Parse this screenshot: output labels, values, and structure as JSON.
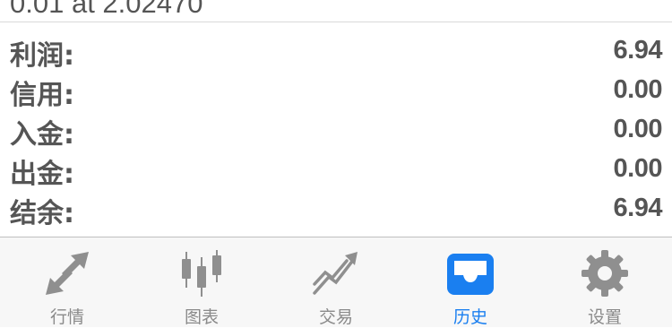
{
  "order_line": "0.01 at 2.02470",
  "summary": {
    "rows": [
      {
        "label": "利润:",
        "value": "6.94"
      },
      {
        "label": "信用:",
        "value": "0.00"
      },
      {
        "label": "入金:",
        "value": "0.00"
      },
      {
        "label": "出金:",
        "value": "0.00"
      },
      {
        "label": "结余:",
        "value": "6.94"
      }
    ]
  },
  "tabbar": {
    "tabs": [
      {
        "label": "行情",
        "icon": "quotes-arrows-icon",
        "active": false
      },
      {
        "label": "图表",
        "icon": "candlestick-chart-icon",
        "active": false
      },
      {
        "label": "交易",
        "icon": "trade-trend-icon",
        "active": false
      },
      {
        "label": "历史",
        "icon": "history-inbox-icon",
        "active": true
      },
      {
        "label": "设置",
        "icon": "gear-icon",
        "active": false
      }
    ],
    "colors": {
      "active": "#1a7ff0",
      "inactive": "#8a8a8a"
    }
  }
}
